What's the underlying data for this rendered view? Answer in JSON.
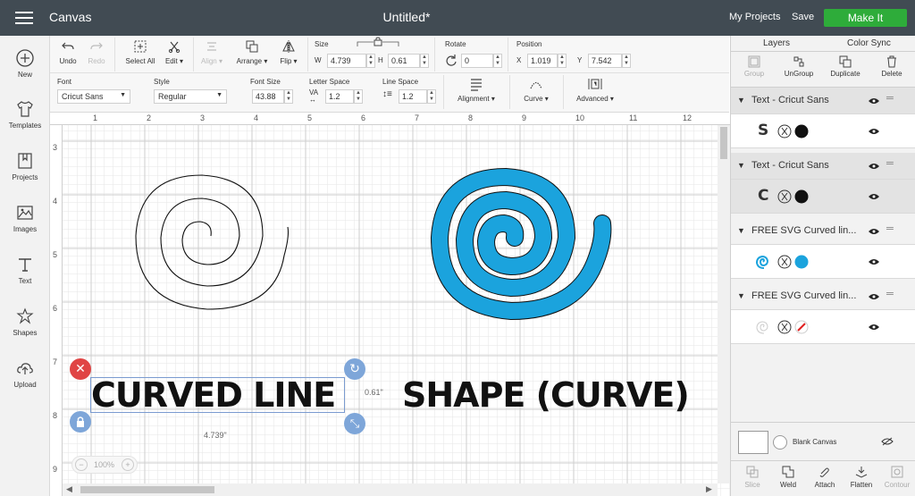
{
  "header": {
    "app_name": "Canvas",
    "doc_title": "Untitled*",
    "my_projects": "My Projects",
    "save": "Save",
    "make_it": "Make It",
    "accent": "#2eac3a"
  },
  "leftbar": {
    "items": [
      {
        "label": "New",
        "icon": "plus-circle-icon"
      },
      {
        "label": "Templates",
        "icon": "tshirt-icon"
      },
      {
        "label": "Projects",
        "icon": "bookmark-icon"
      },
      {
        "label": "Images",
        "icon": "image-icon"
      },
      {
        "label": "Text",
        "icon": "text-icon"
      },
      {
        "label": "Shapes",
        "icon": "shapes-icon"
      },
      {
        "label": "Upload",
        "icon": "cloud-upload-icon"
      }
    ]
  },
  "toolbar": {
    "undo": "Undo",
    "redo": "Redo",
    "select_all": "Select All",
    "edit": "Edit",
    "align": "Align",
    "arrange": "Arrange",
    "flip": "Flip",
    "size_label": "Size",
    "w_label": "W",
    "w_value": "4.739",
    "h_label": "H",
    "h_value": "0.61",
    "rotate_label": "Rotate",
    "rotate_value": "0",
    "position_label": "Position",
    "x_label": "X",
    "x_value": "1.019",
    "y_label": "Y",
    "y_value": "7.542",
    "font_label": "Font",
    "font_value": "Cricut Sans",
    "style_label": "Style",
    "style_value": "Regular",
    "font_size_label": "Font Size",
    "font_size_value": "43.88",
    "letter_space_label": "Letter Space",
    "letter_space_value": "1.2",
    "line_space_label": "Line Space",
    "line_space_value": "1.2",
    "alignment": "Alignment",
    "curve": "Curve",
    "advanced": "Advanced"
  },
  "canvas": {
    "h_ticks": [
      "1",
      "2",
      "3",
      "4",
      "5",
      "6",
      "7",
      "8",
      "9",
      "10",
      "11",
      "12"
    ],
    "v_ticks": [
      "3",
      "4",
      "5",
      "6",
      "7",
      "8",
      "9"
    ],
    "text_left": "CURVED LINE",
    "text_right": "SHAPE (CURVE)",
    "height_readout": "0.61\"",
    "width_readout": "4.739\"",
    "zoom": "100%",
    "spiral_color": "#1ba3dd"
  },
  "panel": {
    "tab_layers": "Layers",
    "tab_color_sync": "Color Sync",
    "group": "Group",
    "ungroup": "UnGroup",
    "duplicate": "Duplicate",
    "delete": "Delete",
    "layers": [
      {
        "name": "Text - Cricut Sans",
        "glyph": "S"
      },
      {
        "name": "Text - Cricut Sans",
        "glyph": "C"
      },
      {
        "name": "FREE SVG Curved lin...",
        "glyph": ""
      },
      {
        "name": "FREE SVG Curved lin...",
        "glyph": ""
      }
    ],
    "blank_canvas": "Blank Canvas",
    "slice": "Slice",
    "weld": "Weld",
    "attach": "Attach",
    "flatten": "Flatten",
    "contour": "Contour"
  }
}
